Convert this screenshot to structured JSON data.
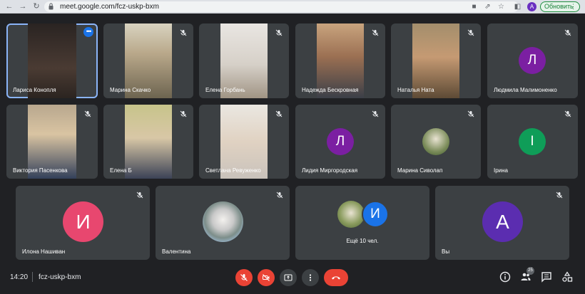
{
  "browser": {
    "url": "meet.google.com/fcz-uskp-bxm",
    "update_button": "Обновить",
    "profile_initial": "A"
  },
  "participants": [
    {
      "name": "Лариса Конопля",
      "type": "video"
    },
    {
      "name": "Марина Скачко",
      "type": "video"
    },
    {
      "name": "Елена Горбань",
      "type": "video"
    },
    {
      "name": "Надежда Бескровная",
      "type": "video"
    },
    {
      "name": "Наталья Ната",
      "type": "video"
    },
    {
      "name": "Людмила Малимоненко",
      "type": "avatar",
      "initial": "Л",
      "color": "#7b1fa2"
    },
    {
      "name": "Виктория Пасенкова",
      "type": "video"
    },
    {
      "name": "Елена Б",
      "type": "video"
    },
    {
      "name": "Светлана Ревуженко",
      "type": "video"
    },
    {
      "name": "Лидия Миргородская",
      "type": "avatar",
      "initial": "Л",
      "color": "#7b1fa2"
    },
    {
      "name": "Марина Сиволап",
      "type": "photo"
    },
    {
      "name": "Ірина",
      "type": "avatar",
      "initial": "І",
      "color": "#0f9d58"
    },
    {
      "name": "Илона Нашиван",
      "type": "avatar",
      "initial": "И",
      "color": "#e8476f"
    },
    {
      "name": "Валентина",
      "type": "photo"
    },
    {
      "name": "Ещё 10 чел.",
      "type": "more",
      "initial": "И",
      "color": "#1a73e8"
    },
    {
      "name": "Вы",
      "type": "avatar",
      "initial": "A",
      "color": "#5b2db0"
    }
  ],
  "bottom_bar": {
    "time": "14:20",
    "meeting_code": "fcz-uskp-bxm",
    "participants_count": "25"
  },
  "colors": {
    "background": "#202124",
    "tile": "#3c4043",
    "danger": "#ea4335",
    "control": "#3c4043"
  }
}
